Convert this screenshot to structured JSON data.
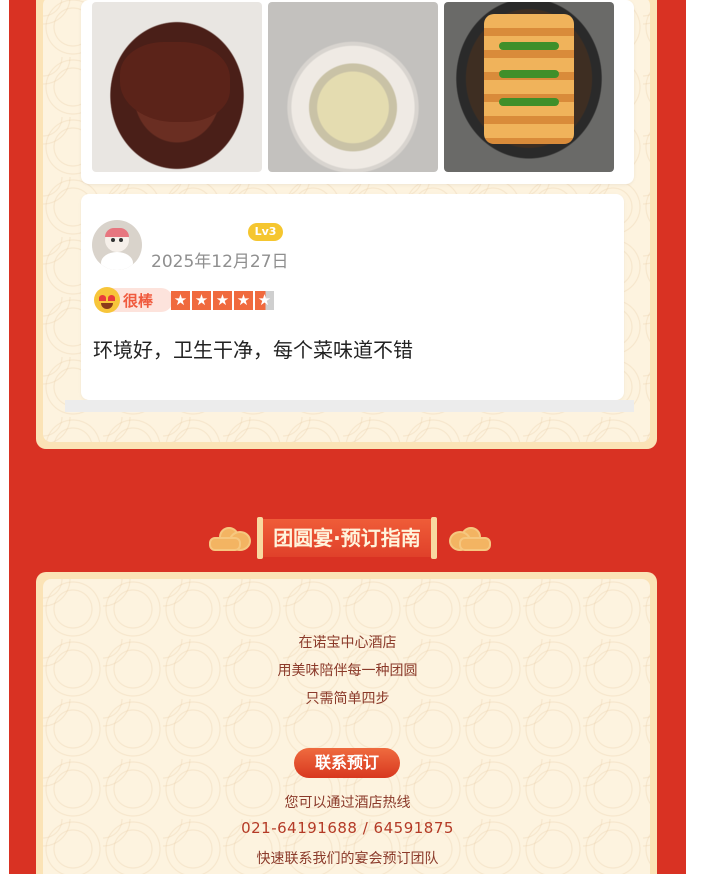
{
  "review_section": {
    "reviewer": {
      "level_badge": "Lv3",
      "date": "2025年12月27日"
    },
    "rating_tag": "很棒",
    "rating_stars": 4.5,
    "star_glyphs": [
      "★",
      "★",
      "★",
      "★",
      "★"
    ],
    "comment": "环境好，卫生干净，每个菜味道不错"
  },
  "booking_section": {
    "title": "团圆宴·预订指南",
    "intro_lines": [
      "在诺宝中心酒店",
      "用美味陪伴每一种团圆",
      "只需简单四步"
    ],
    "contact_button": "联系预订",
    "hotline_label": "您可以通过酒店热线",
    "phone_numbers": "021-64191688 / 64591875",
    "team_line": "快速联系我们的宴会预订团队"
  },
  "colors": {
    "page_background": "#d93223",
    "panel_border": "#fbe3b6",
    "accent_orange": "#f06a3e",
    "level_badge": "#f5c62f"
  }
}
